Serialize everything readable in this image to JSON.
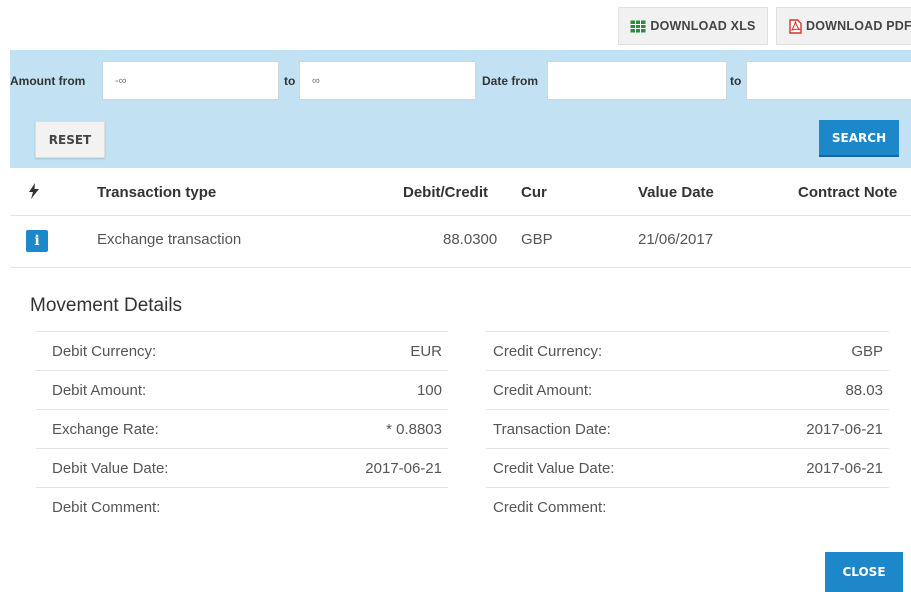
{
  "toolbar": {
    "download_xls": "DOWNLOAD XLS",
    "download_pdf": "DOWNLOAD PDF"
  },
  "filter": {
    "amount_from_label": "Amount from",
    "amount_from_placeholder": "-∞",
    "amount_to_label": "to",
    "amount_to_placeholder": "∞",
    "date_from_label": "Date from",
    "date_from_value": "",
    "date_to_label": "to",
    "date_to_value": "",
    "reset_label": "RESET",
    "search_label": "SEARCH"
  },
  "table": {
    "headers": [
      "Transaction type",
      "Debit/Credit",
      "Cur",
      "Value Date",
      "Contract Note"
    ],
    "rows": [
      {
        "type": "Exchange transaction",
        "amount": "88.0300",
        "currency": "GBP",
        "value_date": "21/06/2017",
        "contract_note": ""
      }
    ]
  },
  "details": {
    "title": "Movement Details",
    "debit": [
      {
        "label": "Debit Currency:",
        "value": "EUR"
      },
      {
        "label": "Debit Amount:",
        "value": "100"
      },
      {
        "label": "Exchange Rate:",
        "value": "* 0.8803"
      },
      {
        "label": "Debit Value Date:",
        "value": "2017-06-21"
      },
      {
        "label": "Debit Comment:",
        "value": ""
      }
    ],
    "credit": [
      {
        "label": "Credit Currency:",
        "value": "GBP"
      },
      {
        "label": "Credit Amount:",
        "value": "88.03"
      },
      {
        "label": "Transaction Date:",
        "value": "2017-06-21"
      },
      {
        "label": "Credit Value Date:",
        "value": "2017-06-21"
      },
      {
        "label": "Credit Comment:",
        "value": ""
      }
    ]
  },
  "footer": {
    "close_label": "CLOSE"
  },
  "colors": {
    "accent": "#1c87c9",
    "filter_bg": "#c2e2f3",
    "xls_icon": "#2e8b3a",
    "pdf_icon": "#d9302c"
  },
  "icons": {
    "xls": "table-grid-icon",
    "pdf": "pdf-file-icon",
    "actions": "lightning-icon",
    "info": "info-icon"
  }
}
